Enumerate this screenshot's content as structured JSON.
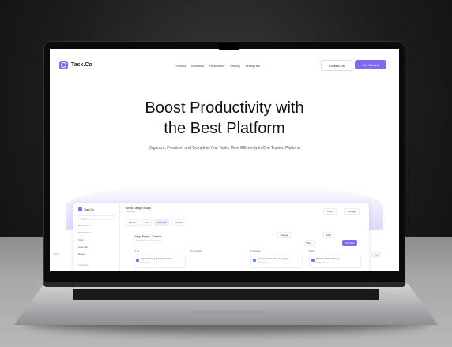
{
  "brand": {
    "name": "Task.Co"
  },
  "nav": {
    "items": [
      "Product",
      "Solutions",
      "Resources",
      "Pricing",
      "Enterprise"
    ]
  },
  "cta": {
    "contact": "Contact Us",
    "start": "Get Started"
  },
  "hero": {
    "title_line1": "Boost Productivity with",
    "title_line2": "the Best Platform",
    "subtitle": "Organize, Prioritize, and Complete Your Tasks More Efficiently in One Trusted Platform"
  },
  "app": {
    "sidebar": {
      "brand": "Task.Co",
      "search": "Search",
      "items": [
        "Dashboard",
        "Notifications",
        "Task",
        "Calendar",
        "Report"
      ],
      "section": "Favorites"
    },
    "workspace_title": "Brand Design Studio",
    "workspace_sub": "Workspace",
    "tabs": [
      "Kanban",
      "List",
      "Calendar",
      "Timeline"
    ],
    "header_buttons": [
      "Invite",
      "Manage"
    ],
    "project_title": "Design Project - Timeline",
    "project_meta": [
      "In Progress",
      "Due Soon",
      "Team"
    ],
    "tools": [
      "Manage",
      "Share",
      "Filter",
      "Add Task"
    ],
    "columns": [
      "To Do",
      "In Progress",
      "In Review",
      "Done"
    ],
    "cards": [
      {
        "title": "Figma Redesign & Implementation",
        "sub": "Design · Due"
      },
      {
        "title": "Homepage Wireframe & Landing",
        "sub": "Design · Due"
      },
      {
        "title": "Marketing Brand Strategy",
        "sub": "Design · Due"
      }
    ],
    "edge_left": "Spline",
    "edge_right": "Add"
  },
  "colors": {
    "accent": "#7b6cf2",
    "text": "#111111"
  }
}
